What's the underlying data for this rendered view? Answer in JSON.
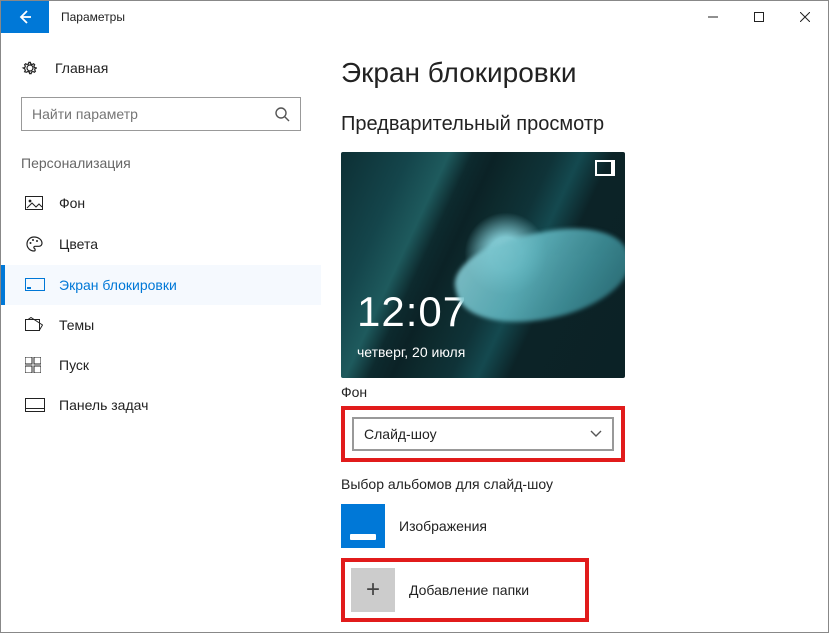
{
  "titlebar": {
    "app_name": "Параметры"
  },
  "sidebar": {
    "home_label": "Главная",
    "search_placeholder": "Найти параметр",
    "section": "Персонализация",
    "items": [
      {
        "label": "Фон"
      },
      {
        "label": "Цвета"
      },
      {
        "label": "Экран блокировки"
      },
      {
        "label": "Темы"
      },
      {
        "label": "Пуск"
      },
      {
        "label": "Панель задач"
      }
    ]
  },
  "main": {
    "title": "Экран блокировки",
    "preview_label": "Предварительный просмотр",
    "clock": "12:07",
    "date": "четверг, 20 июля",
    "background_label": "Фон",
    "background_value": "Слайд-шоу",
    "albums_label": "Выбор альбомов для слайд-шоу",
    "album_name": "Изображения",
    "add_folder_label": "Добавление папки"
  }
}
